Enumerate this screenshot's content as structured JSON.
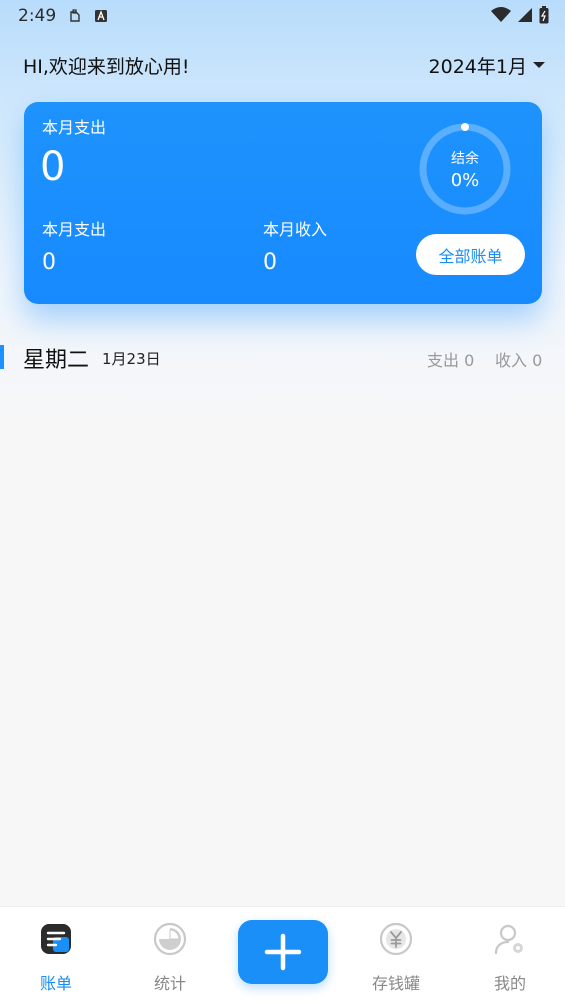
{
  "status_bar": {
    "time": "2:49",
    "icons": [
      "clipboard-icon",
      "a-badge-icon",
      "wifi-icon",
      "signal-icon",
      "battery-icon"
    ]
  },
  "header": {
    "greeting": "HI,欢迎来到放心用!",
    "month": "2024年1月"
  },
  "summary": {
    "main_label": "本月支出",
    "main_value": "0",
    "expense_label": "本月支出",
    "expense_value": "0",
    "income_label": "本月收入",
    "income_value": "0",
    "ring_label": "结余",
    "ring_value": "0%",
    "ring_progress": 0,
    "all_bills_label": "全部账单"
  },
  "day_group": {
    "weekday": "星期二",
    "date": "1月23日",
    "expense_text": "支出 0",
    "income_text": "收入 0"
  },
  "tabbar": {
    "items": [
      {
        "label": "账单",
        "icon": "bill-icon",
        "active": true
      },
      {
        "label": "统计",
        "icon": "pie-chart-icon",
        "active": false
      },
      {
        "label": "存钱罐",
        "icon": "yuan-coin-icon",
        "active": false
      },
      {
        "label": "我的",
        "icon": "profile-icon",
        "active": false
      }
    ],
    "add_icon": "plus-icon"
  },
  "colors": {
    "accent": "#1a8cf5",
    "card": "#1e93fc",
    "inactive": "#888888"
  }
}
